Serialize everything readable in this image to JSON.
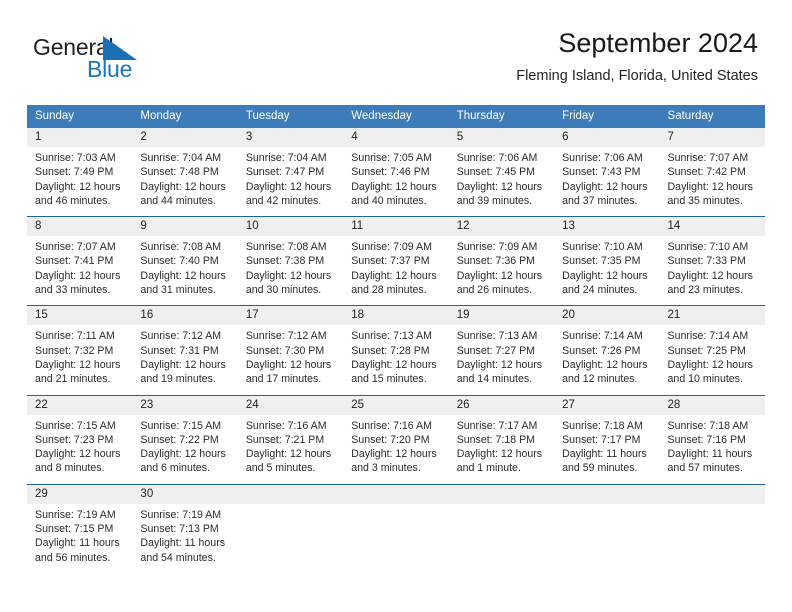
{
  "logo": {
    "word1": "General",
    "word2": "Blue",
    "triangle_color": "#1a6fb5",
    "blue_color": "#1a74bb"
  },
  "header": {
    "title": "September 2024",
    "subtitle": "Fleming Island, Florida, United States"
  },
  "theme": {
    "header_row_bg": "#3c7cba",
    "week_divider": "#20639e",
    "daynum_bg": "#efefef"
  },
  "weekday_headers": [
    "Sunday",
    "Monday",
    "Tuesday",
    "Wednesday",
    "Thursday",
    "Friday",
    "Saturday"
  ],
  "weeks": [
    {
      "days": [
        {
          "num": "1",
          "sunrise": "Sunrise: 7:03 AM",
          "sunset": "Sunset: 7:49 PM",
          "daylight1": "Daylight: 12 hours",
          "daylight2": "and 46 minutes."
        },
        {
          "num": "2",
          "sunrise": "Sunrise: 7:04 AM",
          "sunset": "Sunset: 7:48 PM",
          "daylight1": "Daylight: 12 hours",
          "daylight2": "and 44 minutes."
        },
        {
          "num": "3",
          "sunrise": "Sunrise: 7:04 AM",
          "sunset": "Sunset: 7:47 PM",
          "daylight1": "Daylight: 12 hours",
          "daylight2": "and 42 minutes."
        },
        {
          "num": "4",
          "sunrise": "Sunrise: 7:05 AM",
          "sunset": "Sunset: 7:46 PM",
          "daylight1": "Daylight: 12 hours",
          "daylight2": "and 40 minutes."
        },
        {
          "num": "5",
          "sunrise": "Sunrise: 7:06 AM",
          "sunset": "Sunset: 7:45 PM",
          "daylight1": "Daylight: 12 hours",
          "daylight2": "and 39 minutes."
        },
        {
          "num": "6",
          "sunrise": "Sunrise: 7:06 AM",
          "sunset": "Sunset: 7:43 PM",
          "daylight1": "Daylight: 12 hours",
          "daylight2": "and 37 minutes."
        },
        {
          "num": "7",
          "sunrise": "Sunrise: 7:07 AM",
          "sunset": "Sunset: 7:42 PM",
          "daylight1": "Daylight: 12 hours",
          "daylight2": "and 35 minutes."
        }
      ]
    },
    {
      "days": [
        {
          "num": "8",
          "sunrise": "Sunrise: 7:07 AM",
          "sunset": "Sunset: 7:41 PM",
          "daylight1": "Daylight: 12 hours",
          "daylight2": "and 33 minutes."
        },
        {
          "num": "9",
          "sunrise": "Sunrise: 7:08 AM",
          "sunset": "Sunset: 7:40 PM",
          "daylight1": "Daylight: 12 hours",
          "daylight2": "and 31 minutes."
        },
        {
          "num": "10",
          "sunrise": "Sunrise: 7:08 AM",
          "sunset": "Sunset: 7:38 PM",
          "daylight1": "Daylight: 12 hours",
          "daylight2": "and 30 minutes."
        },
        {
          "num": "11",
          "sunrise": "Sunrise: 7:09 AM",
          "sunset": "Sunset: 7:37 PM",
          "daylight1": "Daylight: 12 hours",
          "daylight2": "and 28 minutes."
        },
        {
          "num": "12",
          "sunrise": "Sunrise: 7:09 AM",
          "sunset": "Sunset: 7:36 PM",
          "daylight1": "Daylight: 12 hours",
          "daylight2": "and 26 minutes."
        },
        {
          "num": "13",
          "sunrise": "Sunrise: 7:10 AM",
          "sunset": "Sunset: 7:35 PM",
          "daylight1": "Daylight: 12 hours",
          "daylight2": "and 24 minutes."
        },
        {
          "num": "14",
          "sunrise": "Sunrise: 7:10 AM",
          "sunset": "Sunset: 7:33 PM",
          "daylight1": "Daylight: 12 hours",
          "daylight2": "and 23 minutes."
        }
      ]
    },
    {
      "days": [
        {
          "num": "15",
          "sunrise": "Sunrise: 7:11 AM",
          "sunset": "Sunset: 7:32 PM",
          "daylight1": "Daylight: 12 hours",
          "daylight2": "and 21 minutes."
        },
        {
          "num": "16",
          "sunrise": "Sunrise: 7:12 AM",
          "sunset": "Sunset: 7:31 PM",
          "daylight1": "Daylight: 12 hours",
          "daylight2": "and 19 minutes."
        },
        {
          "num": "17",
          "sunrise": "Sunrise: 7:12 AM",
          "sunset": "Sunset: 7:30 PM",
          "daylight1": "Daylight: 12 hours",
          "daylight2": "and 17 minutes."
        },
        {
          "num": "18",
          "sunrise": "Sunrise: 7:13 AM",
          "sunset": "Sunset: 7:28 PM",
          "daylight1": "Daylight: 12 hours",
          "daylight2": "and 15 minutes."
        },
        {
          "num": "19",
          "sunrise": "Sunrise: 7:13 AM",
          "sunset": "Sunset: 7:27 PM",
          "daylight1": "Daylight: 12 hours",
          "daylight2": "and 14 minutes."
        },
        {
          "num": "20",
          "sunrise": "Sunrise: 7:14 AM",
          "sunset": "Sunset: 7:26 PM",
          "daylight1": "Daylight: 12 hours",
          "daylight2": "and 12 minutes."
        },
        {
          "num": "21",
          "sunrise": "Sunrise: 7:14 AM",
          "sunset": "Sunset: 7:25 PM",
          "daylight1": "Daylight: 12 hours",
          "daylight2": "and 10 minutes."
        }
      ]
    },
    {
      "days": [
        {
          "num": "22",
          "sunrise": "Sunrise: 7:15 AM",
          "sunset": "Sunset: 7:23 PM",
          "daylight1": "Daylight: 12 hours",
          "daylight2": "and 8 minutes."
        },
        {
          "num": "23",
          "sunrise": "Sunrise: 7:15 AM",
          "sunset": "Sunset: 7:22 PM",
          "daylight1": "Daylight: 12 hours",
          "daylight2": "and 6 minutes."
        },
        {
          "num": "24",
          "sunrise": "Sunrise: 7:16 AM",
          "sunset": "Sunset: 7:21 PM",
          "daylight1": "Daylight: 12 hours",
          "daylight2": "and 5 minutes."
        },
        {
          "num": "25",
          "sunrise": "Sunrise: 7:16 AM",
          "sunset": "Sunset: 7:20 PM",
          "daylight1": "Daylight: 12 hours",
          "daylight2": "and 3 minutes."
        },
        {
          "num": "26",
          "sunrise": "Sunrise: 7:17 AM",
          "sunset": "Sunset: 7:18 PM",
          "daylight1": "Daylight: 12 hours",
          "daylight2": "and 1 minute."
        },
        {
          "num": "27",
          "sunrise": "Sunrise: 7:18 AM",
          "sunset": "Sunset: 7:17 PM",
          "daylight1": "Daylight: 11 hours",
          "daylight2": "and 59 minutes."
        },
        {
          "num": "28",
          "sunrise": "Sunrise: 7:18 AM",
          "sunset": "Sunset: 7:16 PM",
          "daylight1": "Daylight: 11 hours",
          "daylight2": "and 57 minutes."
        }
      ]
    },
    {
      "days": [
        {
          "num": "29",
          "sunrise": "Sunrise: 7:19 AM",
          "sunset": "Sunset: 7:15 PM",
          "daylight1": "Daylight: 11 hours",
          "daylight2": "and 56 minutes."
        },
        {
          "num": "30",
          "sunrise": "Sunrise: 7:19 AM",
          "sunset": "Sunset: 7:13 PM",
          "daylight1": "Daylight: 11 hours",
          "daylight2": "and 54 minutes."
        },
        {
          "num": "",
          "sunrise": "",
          "sunset": "",
          "daylight1": "",
          "daylight2": ""
        },
        {
          "num": "",
          "sunrise": "",
          "sunset": "",
          "daylight1": "",
          "daylight2": ""
        },
        {
          "num": "",
          "sunrise": "",
          "sunset": "",
          "daylight1": "",
          "daylight2": ""
        },
        {
          "num": "",
          "sunrise": "",
          "sunset": "",
          "daylight1": "",
          "daylight2": ""
        },
        {
          "num": "",
          "sunrise": "",
          "sunset": "",
          "daylight1": "",
          "daylight2": ""
        }
      ]
    }
  ]
}
